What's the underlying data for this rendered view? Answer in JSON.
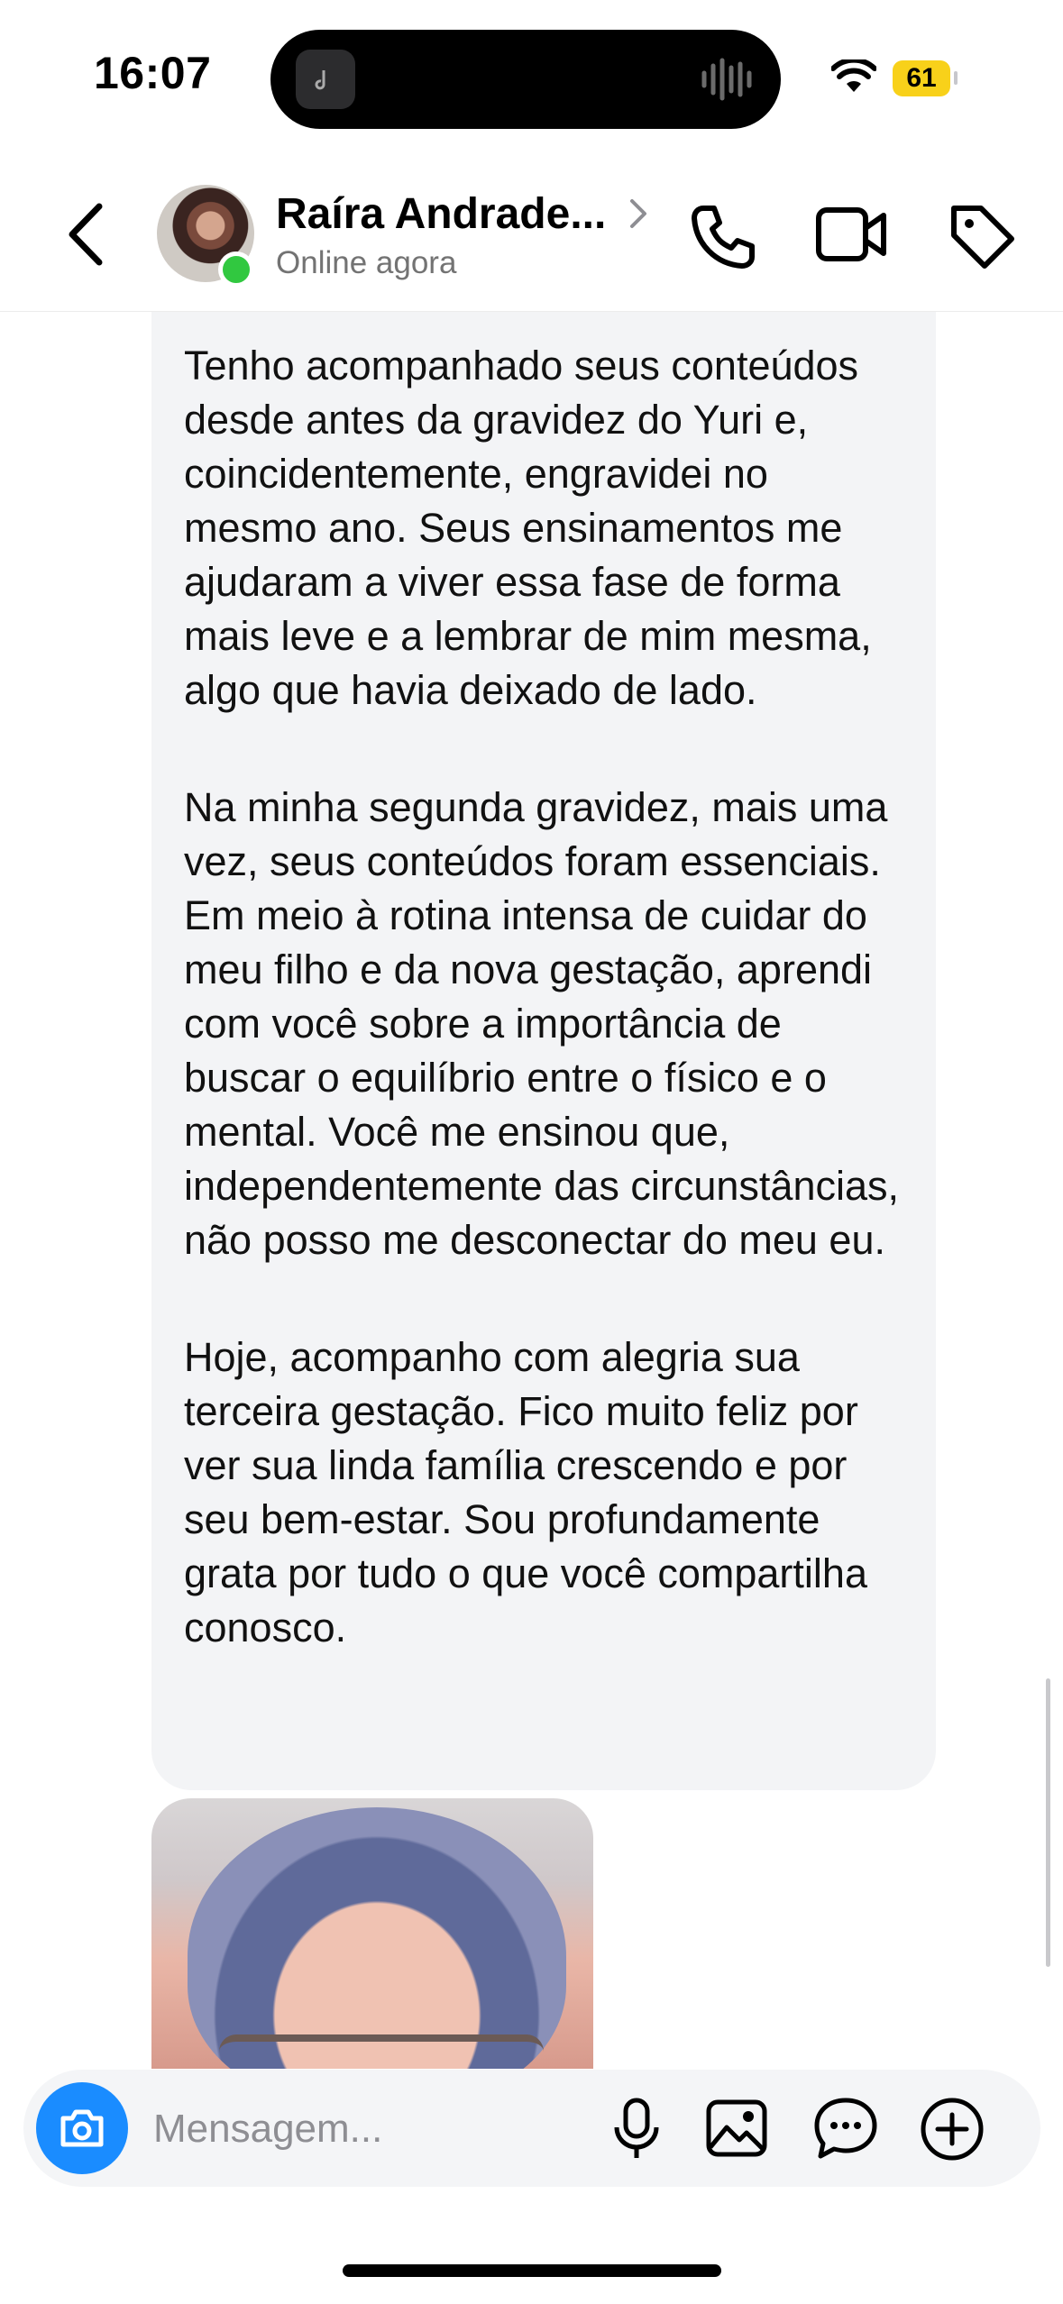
{
  "status_bar": {
    "time": "16:07",
    "battery": "61",
    "wifi_icon": "wifi-icon",
    "battery_color": "#f8d11a"
  },
  "header": {
    "contact_name": "Raíra Andrade...",
    "contact_status": "Online agora",
    "icons": [
      "back-arrow-icon",
      "chevron-right-icon",
      "phone-icon",
      "video-camera-icon",
      "tag-icon"
    ],
    "online_color": "#31c840"
  },
  "message": {
    "paragraphs": [
      "Tenho acompanhado seus conteúdos desde antes da gravidez do Yuri e, coincidentemente, engravidei no mesmo ano. Seus ensinamentos me ajudaram a viver essa fase de forma mais leve e a lembrar de mim mesma, algo que havia deixado de lado.",
      "Na minha segunda gravidez, mais uma vez, seus conteúdos foram essenciais. Em meio à rotina intensa de cuidar do meu filho e da nova gestação, aprendi com você sobre a importância de buscar o equilíbrio entre o físico e o mental. Você me ensinou que, independentemente das circunstâncias, não posso me desconectar do meu eu.",
      "Hoje, acompanho com alegria sua terceira gestação. Fico muito feliz por ver sua linda família crescendo e por seu bem-estar. Sou profundamente grata por tudo o que você compartilha conosco."
    ],
    "bubble_color": "#f3f4f6"
  },
  "composer": {
    "placeholder": "Mensagem...",
    "icons": [
      "camera-icon",
      "microphone-icon",
      "image-icon",
      "sticker-chat-icon",
      "plus-circle-icon"
    ],
    "camera_color": "#1a8cff"
  }
}
